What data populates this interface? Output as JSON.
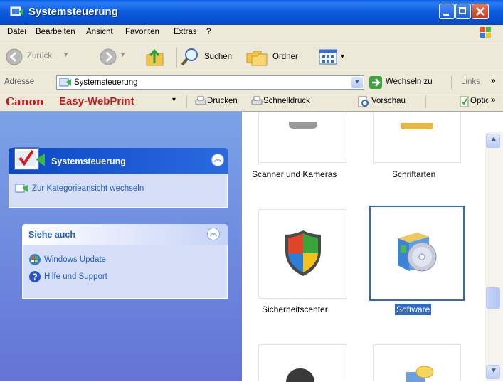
{
  "window": {
    "title": "Systemsteuerung"
  },
  "menu": [
    "Datei",
    "Bearbeiten",
    "Ansicht",
    "Favoriten",
    "Extras",
    "?"
  ],
  "toolbar": {
    "back": "Zurück",
    "search": "Suchen",
    "folders": "Ordner"
  },
  "address": {
    "label": "Adresse",
    "value": "Systemsteuerung",
    "go": "Wechseln zu",
    "links": "Links"
  },
  "canon": {
    "brand": "Canon",
    "product": "Easy-WebPrint",
    "print": "Drucken",
    "quickprint": "Schnelldruck",
    "preview": "Vorschau",
    "options": "Optic"
  },
  "sidebar": {
    "panel1": {
      "title": "Systemsteuerung",
      "link": "Zur Kategorieansicht wechseln"
    },
    "panel2": {
      "title": "Siehe auch",
      "links": [
        "Windows Update",
        "Hilfe und Support"
      ]
    }
  },
  "items": {
    "scanners": "Scanner und Kameras",
    "fonts": "Schriftarten",
    "security": "Sicherheitscenter",
    "software": "Software"
  }
}
